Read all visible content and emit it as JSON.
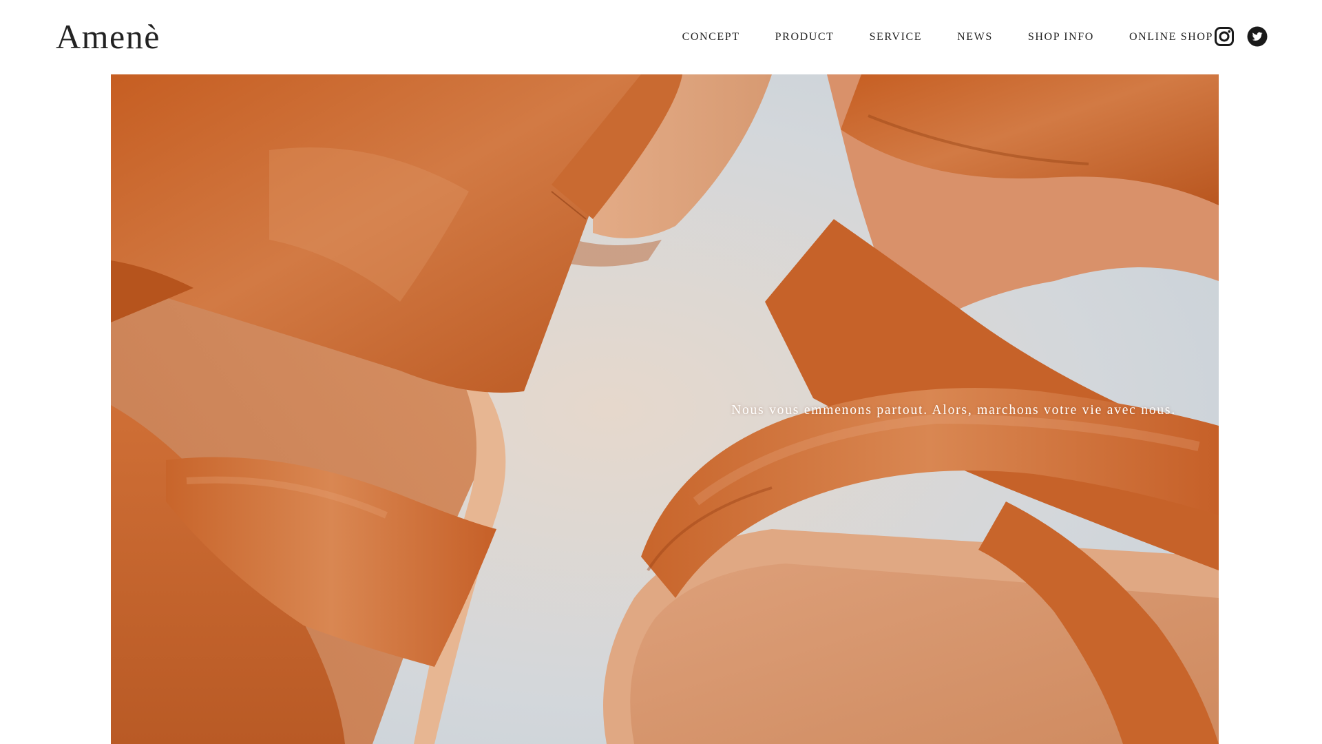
{
  "brand": {
    "logo_text": "Amenè"
  },
  "nav": {
    "items": [
      {
        "label": "CONCEPT"
      },
      {
        "label": "PRODUCT"
      },
      {
        "label": "SERVICE"
      },
      {
        "label": "NEWS"
      },
      {
        "label": "SHOP INFO"
      },
      {
        "label": "ONLINE SHOP"
      }
    ]
  },
  "social": {
    "instagram": "instagram-icon",
    "twitter": "twitter-icon"
  },
  "hero": {
    "tagline": "Nous vous emmenons partout. Alors, marchons votre vie avec nous.",
    "image_subject": "tan leather strappy sandals",
    "colors": {
      "leather": "#c4622a",
      "leather_light": "#d98a55",
      "insole": "#d9946a",
      "background": "#c9d3da"
    }
  },
  "colors": {
    "text": "#222222",
    "background": "#ffffff",
    "tagline": "#ffffff"
  }
}
